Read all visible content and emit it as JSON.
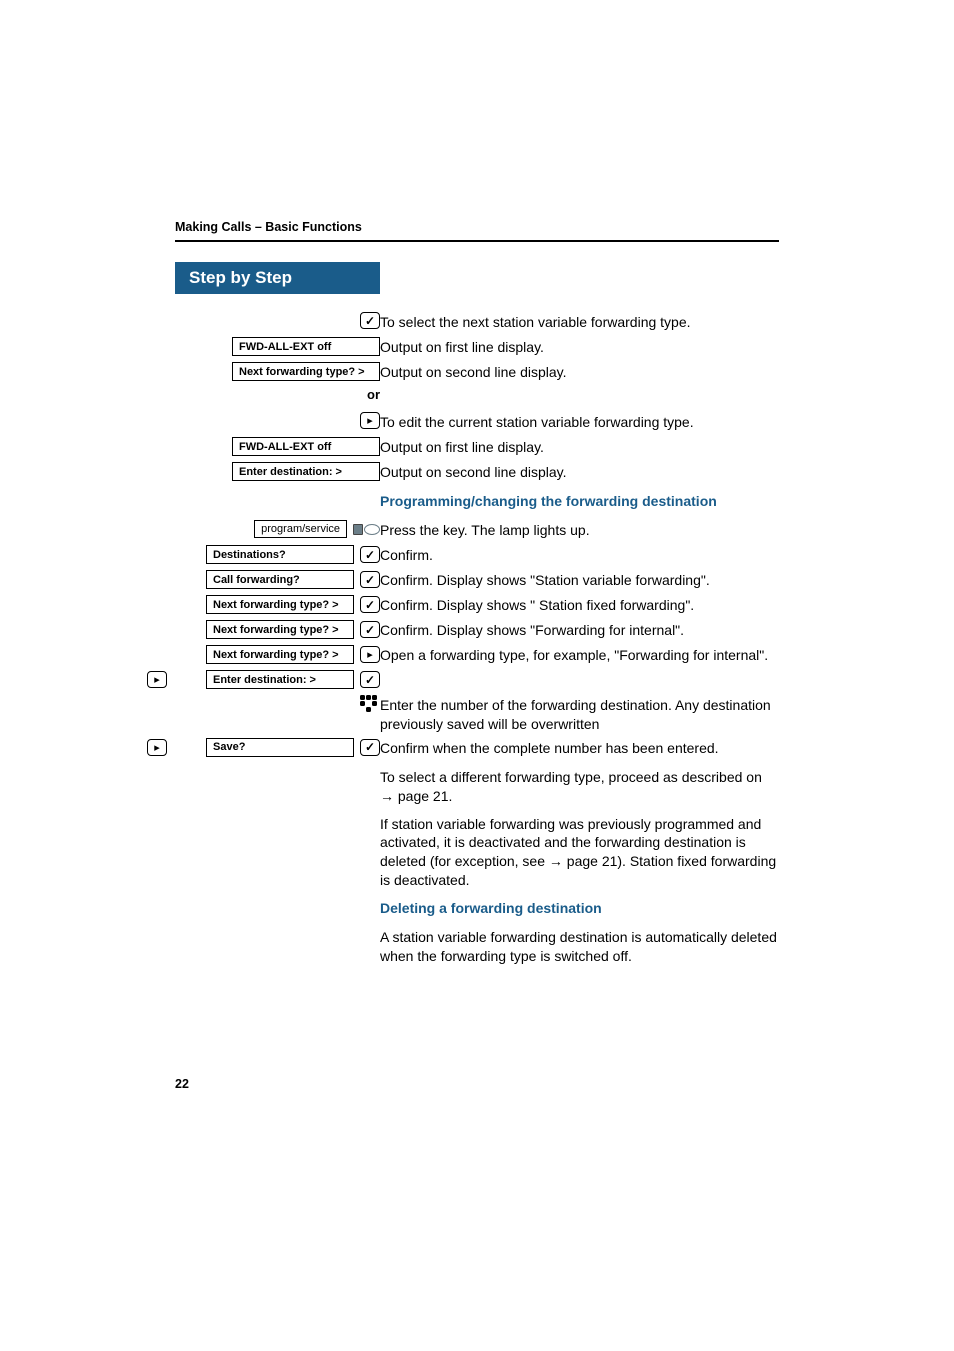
{
  "header": {
    "breadcrumb": "Making Calls – Basic Functions",
    "step_title": "Step by Step"
  },
  "block1": {
    "r1": {
      "text": "To select the next station variable forwarding type."
    },
    "r2": {
      "box": "FWD-ALL-EXT off",
      "text": "Output on first line display."
    },
    "r3": {
      "box": "Next forwarding type?  >",
      "text": "Output on second line display."
    },
    "or": "or",
    "r4": {
      "text": "To edit the current station variable forwarding type."
    },
    "r5": {
      "box": "FWD-ALL-EXT off",
      "text": "Output on first line display."
    },
    "r6": {
      "box": "Enter destination:    >",
      "text": "Output on second line display."
    }
  },
  "prog": {
    "title": "Programming/changing the forwarding destination",
    "r1": {
      "key": "program/service",
      "text": "Press the key. The lamp lights up."
    },
    "r2": {
      "box": "Destinations?",
      "text": "Confirm."
    },
    "r3": {
      "box": "Call forwarding?",
      "text": "Confirm. Display shows \"Station variable forwarding\"."
    },
    "r4": {
      "box": "Next forwarding type?  >",
      "text": "Confirm. Display shows \" Station fixed forwarding\"."
    },
    "r5": {
      "box": "Next forwarding type?  >",
      "text": "Confirm. Display shows \"Forwarding for internal\"."
    },
    "r6": {
      "box": "Next forwarding type?  >",
      "text": "Open a forwarding type, for example, \"Forwarding for internal\"."
    },
    "r7": {
      "box": "Enter destination:    >",
      "text": "Enter the number of the forwarding destination. Any destination previously saved will be overwritten"
    },
    "r8": {
      "box": "Save?",
      "text": "Confirm when the complete number has been entered."
    },
    "p1": "To select a different forwarding type, proceed as described on ",
    "p1_link": "page 21",
    "p1_suffix": ".",
    "p2a": "If station variable forwarding was previously programmed and activated, it is deactivated and the forwarding destination is deleted (for exception, see ",
    "p2_link": "page 21",
    "p2b": "). Station fixed forwarding is deactivated."
  },
  "del": {
    "title": "Deleting a forwarding destination",
    "text": "A station variable forwarding destination is automatically deleted when the forwarding type is switched off."
  },
  "footer": {
    "page": "22"
  }
}
